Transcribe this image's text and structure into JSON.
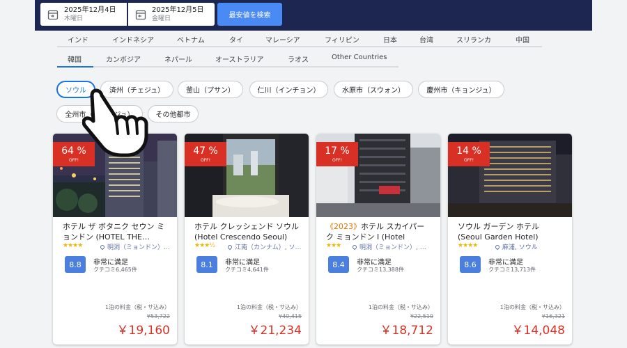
{
  "header": {
    "checkin": {
      "date": "2025年12月4日",
      "weekday": "木曜日"
    },
    "checkout": {
      "date": "2025年12月5日",
      "weekday": "金曜日"
    },
    "search_label": "最安値を検索"
  },
  "countries_row1": [
    "インド",
    "インドネシア",
    "ベトナム",
    "タイ",
    "マレーシア",
    "フィリピン",
    "日本",
    "台湾",
    "スリランカ",
    "中国"
  ],
  "countries_row2": [
    "韓国",
    "カンボジア",
    "ネパール",
    "オーストラリア",
    "ラオス",
    "Other Countries"
  ],
  "cities": [
    "ソウル",
    "済州（チェジュ）",
    "釜山（プサン）",
    "仁川（インチョン）",
    "水原市（スウォン）",
    "慶州市（キョンジュ）",
    "全州市（チョンジュ）",
    "その他都市"
  ],
  "hotels": [
    {
      "discount": "64 %",
      "off": "OFF!",
      "year": "",
      "name": "ホテル ザ ボタニク セウン ミョンドン (HOTEL THE…",
      "stars": "★★★★",
      "location": "明洞（ミョンドン）...",
      "score": "8.8",
      "rating_label": "非常に満足",
      "reviews": "クチコミ6,465件",
      "price_label": "1泊の料金（税・サ込み）",
      "old_price": "¥53,722",
      "price": "￥19,160"
    },
    {
      "discount": "47 %",
      "off": "OFF!",
      "year": "",
      "name": "ホテル クレッシェンド ソウル (Hotel Crescendo Seoul)",
      "stars": "★★★½",
      "location": "江南（カンナム）, ソ…",
      "score": "8.1",
      "rating_label": "非常に満足",
      "reviews": "クチコミ4,641件",
      "price_label": "1泊の料金（税・サ込み）",
      "old_price": "¥40,415",
      "price": "￥21,234"
    },
    {
      "discount": "17 %",
      "off": "OFF!",
      "year": "2023",
      "name": "ホテル スカイパーク ミョンドン I (Hotel Skypar…",
      "stars": "★★★",
      "location": "明洞（ミョンドン）, …",
      "score": "8.4",
      "rating_label": "非常に満足",
      "reviews": "クチコミ13,388件",
      "price_label": "1泊の料金（税・サ込み）",
      "old_price": "¥22,510",
      "price": "￥18,712"
    },
    {
      "discount": "14 %",
      "off": "OFF!",
      "year": "",
      "name": "ソウル ガーデン ホテル (Seoul Garden Hotel)",
      "stars": "★★★★",
      "location": "麻浦, ソウル",
      "score": "8.6",
      "rating_label": "非常に満足",
      "reviews": "クチコミ13,713件",
      "price_label": "1泊の料金（税・サ込み）",
      "old_price": "¥16,321",
      "price": "￥14,048"
    }
  ],
  "colors": {
    "navy": "#1d2650",
    "accent": "#1a73e8",
    "discount": "#d93025",
    "star": "#f4b400"
  }
}
